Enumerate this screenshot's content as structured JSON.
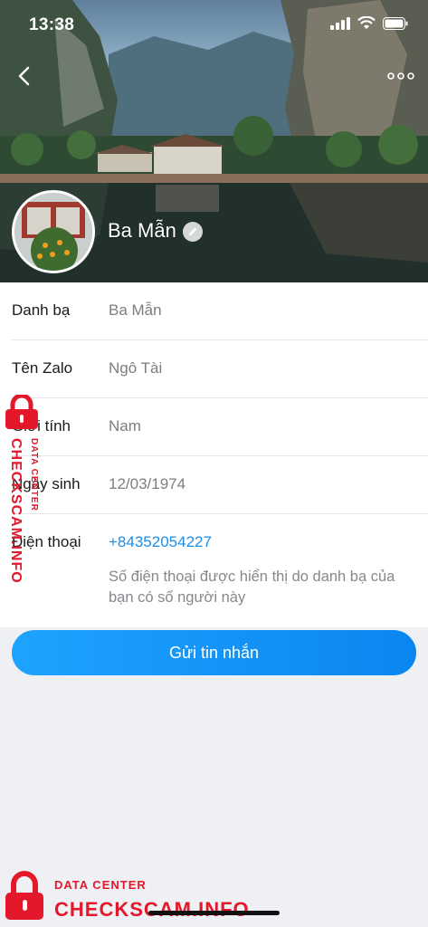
{
  "status_bar": {
    "time": "13:38"
  },
  "header": {
    "profile_name": "Ba Mẫn",
    "back_icon": "chevron-left-icon",
    "more_icon": "more-horizontal-icon",
    "edit_icon": "pencil-icon"
  },
  "info": {
    "rows": [
      {
        "label": "Danh bạ",
        "value": "Ba Mẫn"
      },
      {
        "label": "Tên Zalo",
        "value": "Ngô Tài"
      },
      {
        "label": "Giới tính",
        "value": "Nam"
      },
      {
        "label": "Ngày sinh",
        "value": "12/03/1974"
      },
      {
        "label": "Điện thoại",
        "value": "+84352054227",
        "note": "Số điện thoại được hiển thị do danh bạ của bạn có số người này"
      }
    ]
  },
  "actions": {
    "send_message_label": "Gửi tin nhắn"
  },
  "watermark": {
    "brand": "CHECKSCAM.INFO",
    "subtitle": "DATA CENTER"
  },
  "colors": {
    "accent": "#1b8ee6",
    "button": "#0a86f0",
    "watermark": "#e3182a"
  }
}
